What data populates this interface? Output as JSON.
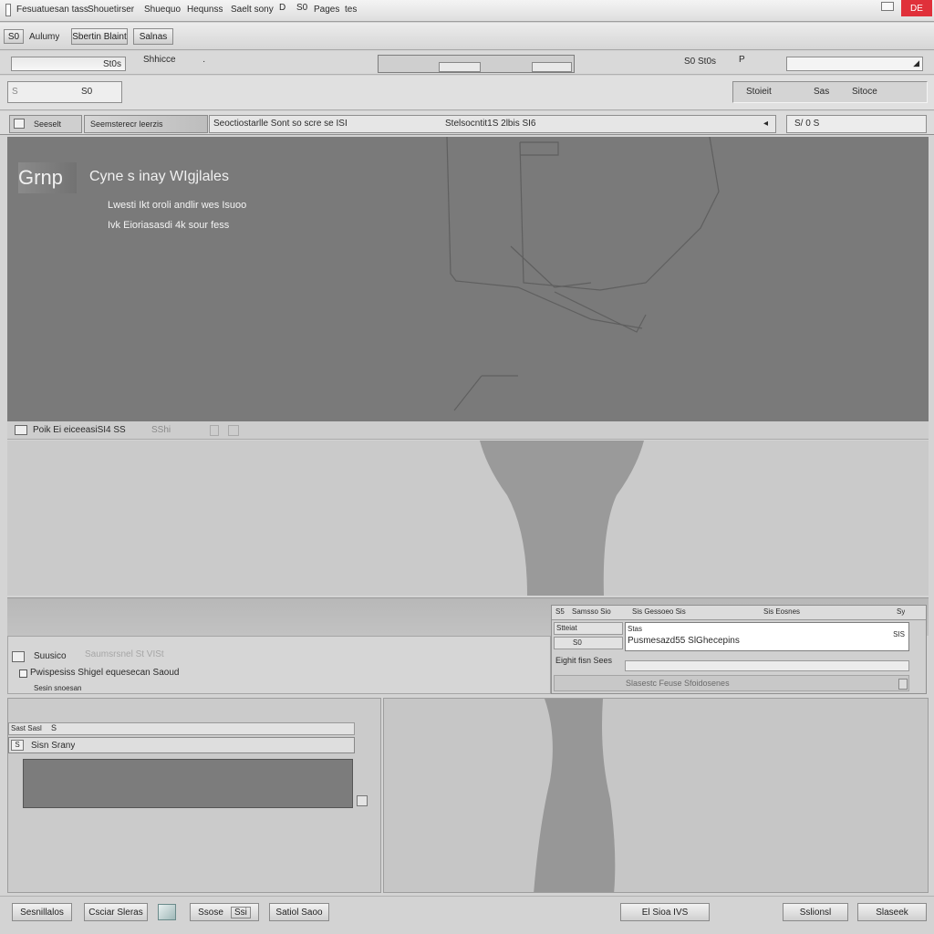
{
  "menubar": {
    "items": [
      "Fesuatuesan tass",
      "Shouetirser",
      "Shuequo",
      "Hequnss",
      "Saelt sony",
      "D",
      "S0",
      "Pages",
      "tes"
    ],
    "close_label": "DE"
  },
  "toolbar1": {
    "button1": "S0",
    "button2": "Aulumy",
    "button3": "Sbertin Blaint",
    "button4": "Salnas"
  },
  "toolbar2": {
    "field_value": "St0s",
    "label": "Shhicce",
    "right_label": "S0 St0s",
    "marker": "P"
  },
  "toolbar3": {
    "left_value": "S",
    "left_right": "S0",
    "right_labels": [
      "Stoieit",
      "Sas",
      "Sitoce"
    ]
  },
  "tabbar": {
    "tab1": "Seeselt",
    "tab2": "Seemsterecr leerzis",
    "crumb": "Seoctiostarlle Sont so scre se ISI",
    "path": "Stelsocntit1S 2lbis SI6",
    "search_label": "S/ 0 S"
  },
  "preview": {
    "app_name": "Grnp",
    "heading": "Cyne s inay WIgjlales",
    "line1": "Lwesti Ikt oroli andlir wes Isuoo",
    "line2": "Ivk Eioriasasdi 4k sour fess"
  },
  "midbar": {
    "label": "Poik Ei eiceeasiSI4 SS",
    "tag": "SShi"
  },
  "lower_left": {
    "title": "Suusico",
    "faded": "Saumsrsnel St VISt",
    "checkbox_label": "Pwispesiss  Shigel equesecan Saoud",
    "note": "Sesin snoesan"
  },
  "dialog": {
    "header": [
      "S5",
      "Samsso Sio",
      "Sis Gessoeo Sis",
      "Sis Eosnes",
      "Sy"
    ],
    "row1_label": "Stteiat",
    "row2_label": "S0",
    "field_label": "Stas",
    "field_value": "Pusmesazd55 SlGhecepins",
    "field_button": "SIS",
    "row3_label": "Eighit fisn Sees",
    "footer": "Slasestc Feuse Sfoidosenes"
  },
  "bottom_panel": {
    "header_label": "Sast Sasl",
    "header_marker": "S",
    "row_label": "Sisn Srany",
    "row_icon": "S"
  },
  "footer_buttons": {
    "b1": "Sesnillalos",
    "b2": "Csciar Sleras",
    "b3_left": "Ssose",
    "b3_right": "Ssi",
    "b4": "Satiol Saoo",
    "b5": "El Sioa IVS",
    "b6": "Sslionsl",
    "b7": "Slaseek"
  },
  "colors": {
    "accent_close": "#e0303a",
    "preview_bg": "#7a7a7a",
    "video_bg": "#cacaca"
  }
}
